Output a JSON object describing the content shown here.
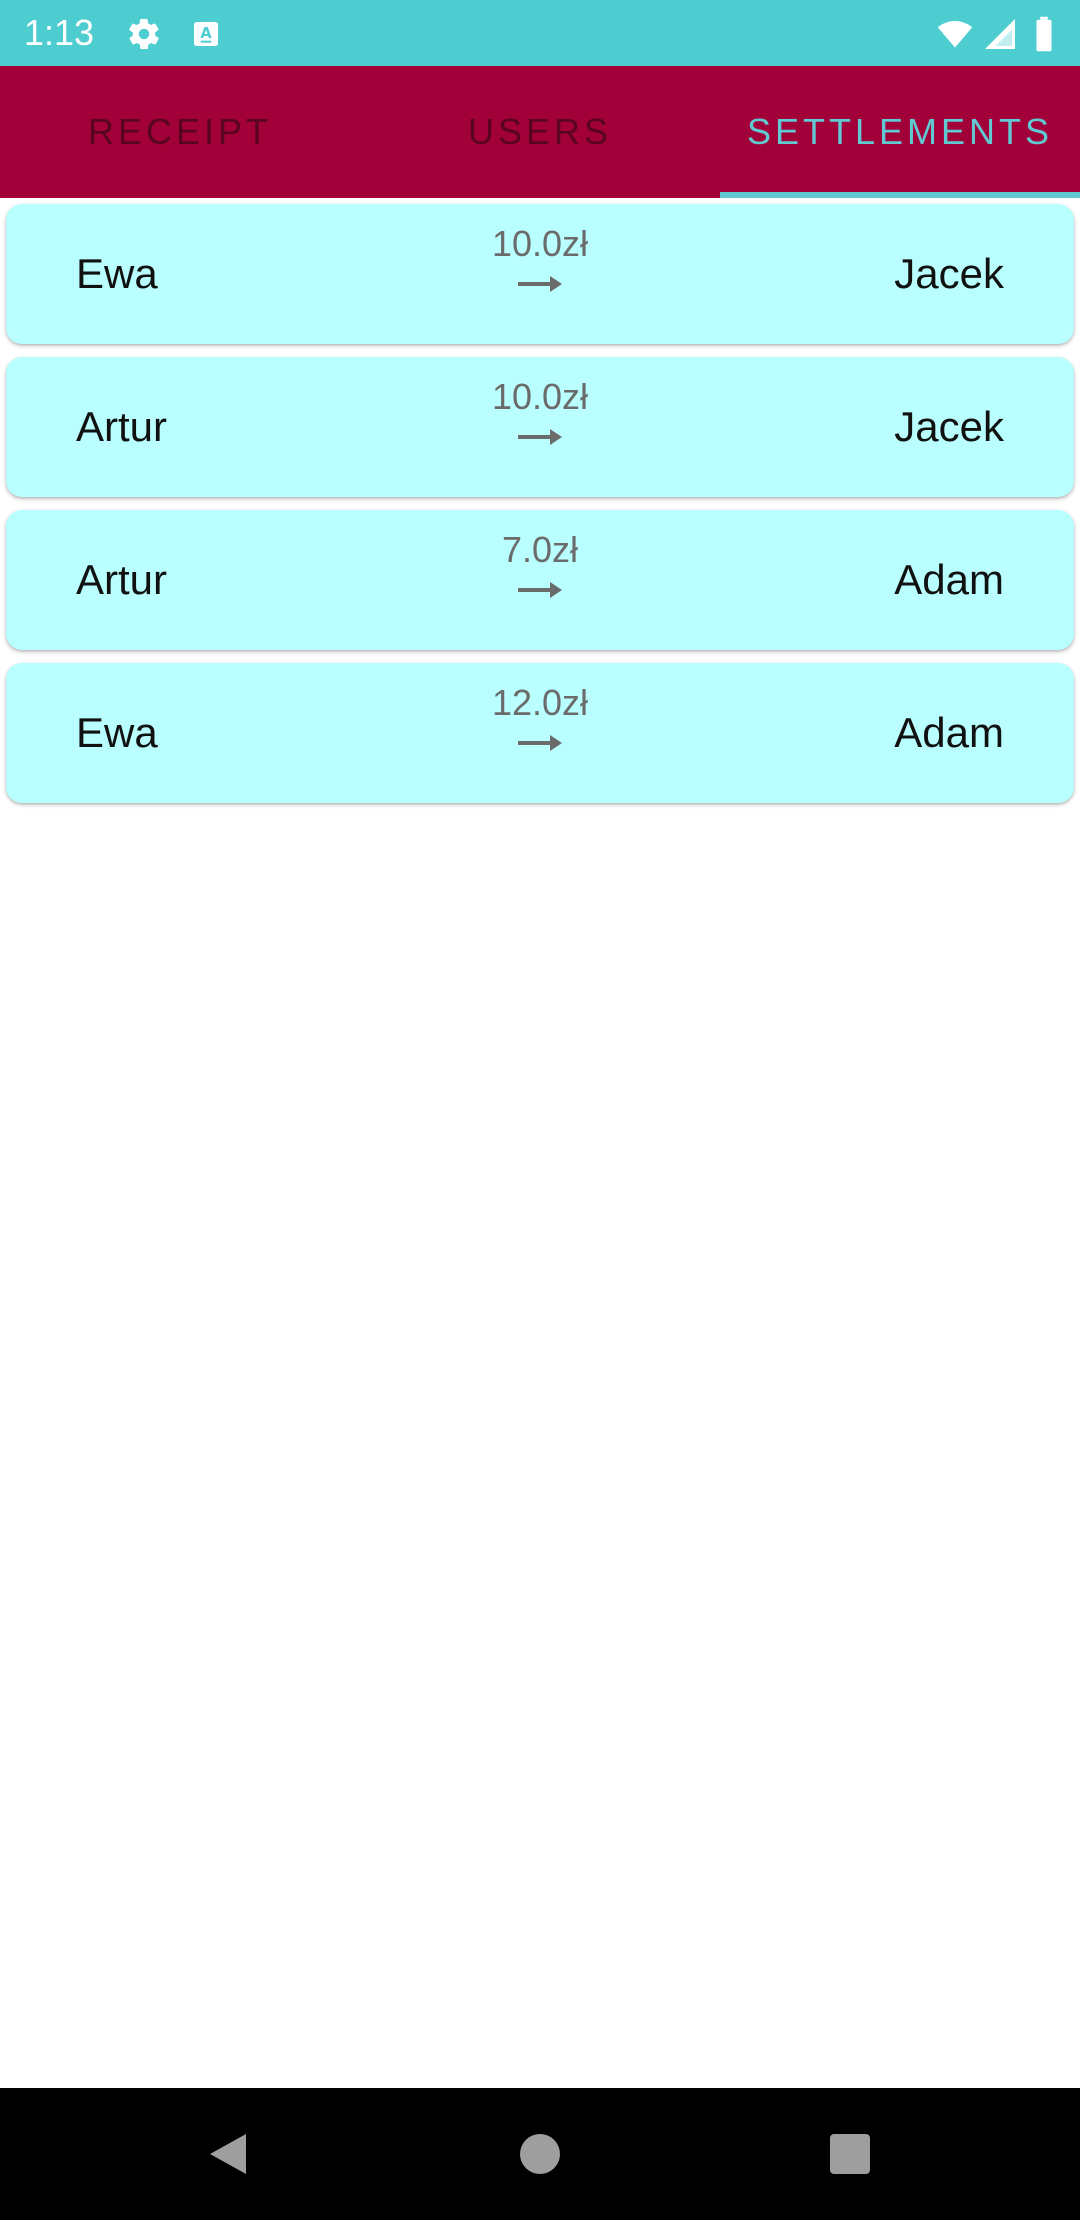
{
  "status_bar": {
    "time": "1:13",
    "icons": [
      "gear-icon",
      "a-text-icon",
      "wifi-icon",
      "signal-icon",
      "battery-icon"
    ],
    "color": "#4ecdd1"
  },
  "tabs": [
    {
      "label": "RECEIPT",
      "active": false
    },
    {
      "label": "USERS",
      "active": false
    },
    {
      "label": "SETTLEMENTS",
      "active": true
    }
  ],
  "colors": {
    "tab_bar": "#a20039",
    "tab_active": "#60c9d1",
    "tab_inactive": "#5a0520",
    "card": "#baffff"
  },
  "settlements": [
    {
      "from": "Ewa",
      "amount": "10.0zł",
      "to": "Jacek"
    },
    {
      "from": "Artur",
      "amount": "10.0zł",
      "to": "Jacek"
    },
    {
      "from": "Artur",
      "amount": "7.0zł",
      "to": "Adam"
    },
    {
      "from": "Ewa",
      "amount": "12.0zł",
      "to": "Adam"
    }
  ],
  "nav_bar": {
    "icons": [
      "back-icon",
      "home-icon",
      "recents-icon"
    ]
  }
}
